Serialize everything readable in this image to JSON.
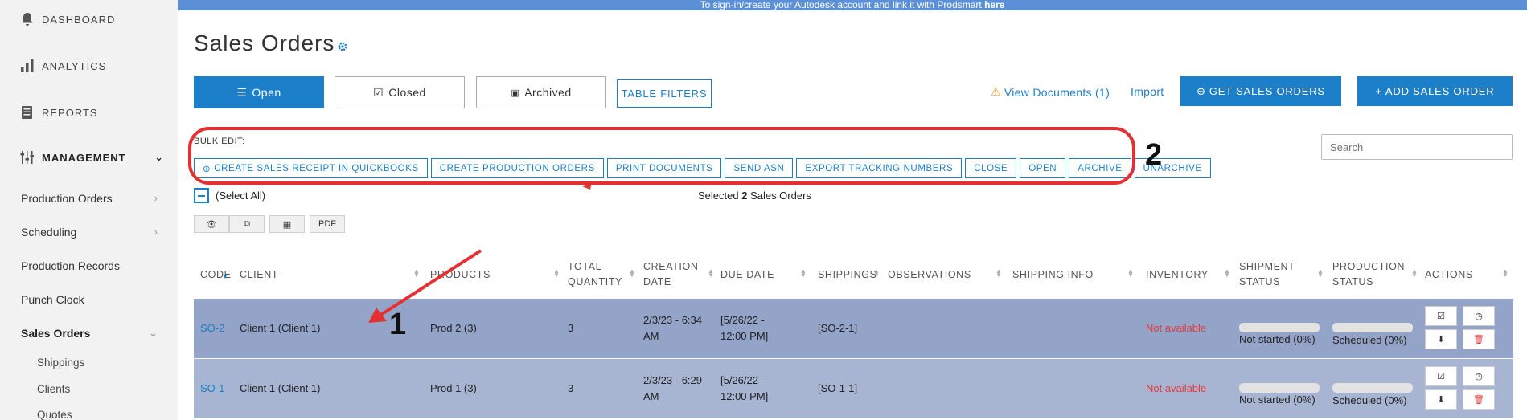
{
  "banner": {
    "text": "To sign-in/create your Autodesk account and link it with Prodsmart ",
    "link": "here"
  },
  "sidebar": {
    "top_items": [
      {
        "label": "DASHBOARD",
        "icon": "bell-icon"
      },
      {
        "label": "ANALYTICS",
        "icon": "bar-chart-icon"
      },
      {
        "label": "REPORTS",
        "icon": "document-icon"
      }
    ],
    "management": {
      "label": "MANAGEMENT",
      "icon": "sliders-icon"
    },
    "sub_items": [
      "Production Orders",
      "Scheduling",
      "Production Records",
      "Punch Clock",
      "Sales Orders"
    ],
    "sales_children": [
      "Shippings",
      "Clients",
      "Quotes"
    ]
  },
  "page": {
    "title": "Sales Orders"
  },
  "tabs": {
    "open": "Open",
    "closed": "Closed",
    "archived": "Archived",
    "table_filters": "TABLE FILTERS"
  },
  "header_actions": {
    "view_documents": "View Documents (1)",
    "import": "Import",
    "get_sales_orders": "GET SALES ORDERS",
    "add_sales_order": "ADD SALES ORDER"
  },
  "bulk": {
    "label": "BULK EDIT:",
    "buttons": [
      "CREATE SALES RECEIPT IN QUICKBOOKS",
      "CREATE PRODUCTION ORDERS",
      "PRINT DOCUMENTS",
      "SEND ASN",
      "EXPORT TRACKING NUMBERS",
      "CLOSE",
      "OPEN",
      "ARCHIVE",
      "UNARCHIVE"
    ]
  },
  "annotations": {
    "one": "1",
    "two": "2"
  },
  "search": {
    "placeholder": "Search"
  },
  "selection": {
    "select_all": "(Select All)",
    "prefix": "Selected ",
    "count": "2",
    "suffix": " Sales Orders"
  },
  "tools": {
    "pdf": "PDF"
  },
  "table": {
    "headers": {
      "code": "CODE",
      "client": "CLIENT",
      "products": "PRODUCTS",
      "total_quantity": "TOTAL QUANTITY",
      "creation_date": "CREATION DATE",
      "due_date": "DUE DATE",
      "shippings": "SHIPPINGS",
      "observations": "OBSERVATIONS",
      "shipping_info": "SHIPPING INFO",
      "inventory": "INVENTORY",
      "shipment_status": "SHIPMENT STATUS",
      "production_status": "PRODUCTION STATUS",
      "actions": "ACTIONS"
    },
    "rows": [
      {
        "code": "SO-2",
        "client": "Client 1 (Client 1)",
        "products": "Prod 2 (3)",
        "total_quantity": "3",
        "creation_date": "2/3/23 - 6:34 AM",
        "due_date": "[5/26/22 - 12:00 PM]",
        "shippings": "[SO-2-1]",
        "inventory": "Not available",
        "shipment_status": "Not started (0%)",
        "shipment_progress": 0,
        "production_status": "Scheduled (0%)",
        "production_progress": 0
      },
      {
        "code": "SO-1",
        "client": "Client 1 (Client 1)",
        "products": "Prod 1 (3)",
        "total_quantity": "3",
        "creation_date": "2/3/23 - 6:29 AM",
        "due_date": "[5/26/22 - 12:00 PM]",
        "shippings": "[SO-1-1]",
        "inventory": "Not available",
        "shipment_status": "Not started (0%)",
        "shipment_progress": 0,
        "production_status": "Scheduled (0%)",
        "production_progress": 0
      }
    ]
  },
  "colors": {
    "primary": "#1c7fc9",
    "banner": "#5b8fd6",
    "row_selected": "#94a4c8",
    "row_selected_alt": "#a7b5d3",
    "danger": "#e23b3b",
    "annotation": "#e43030"
  }
}
